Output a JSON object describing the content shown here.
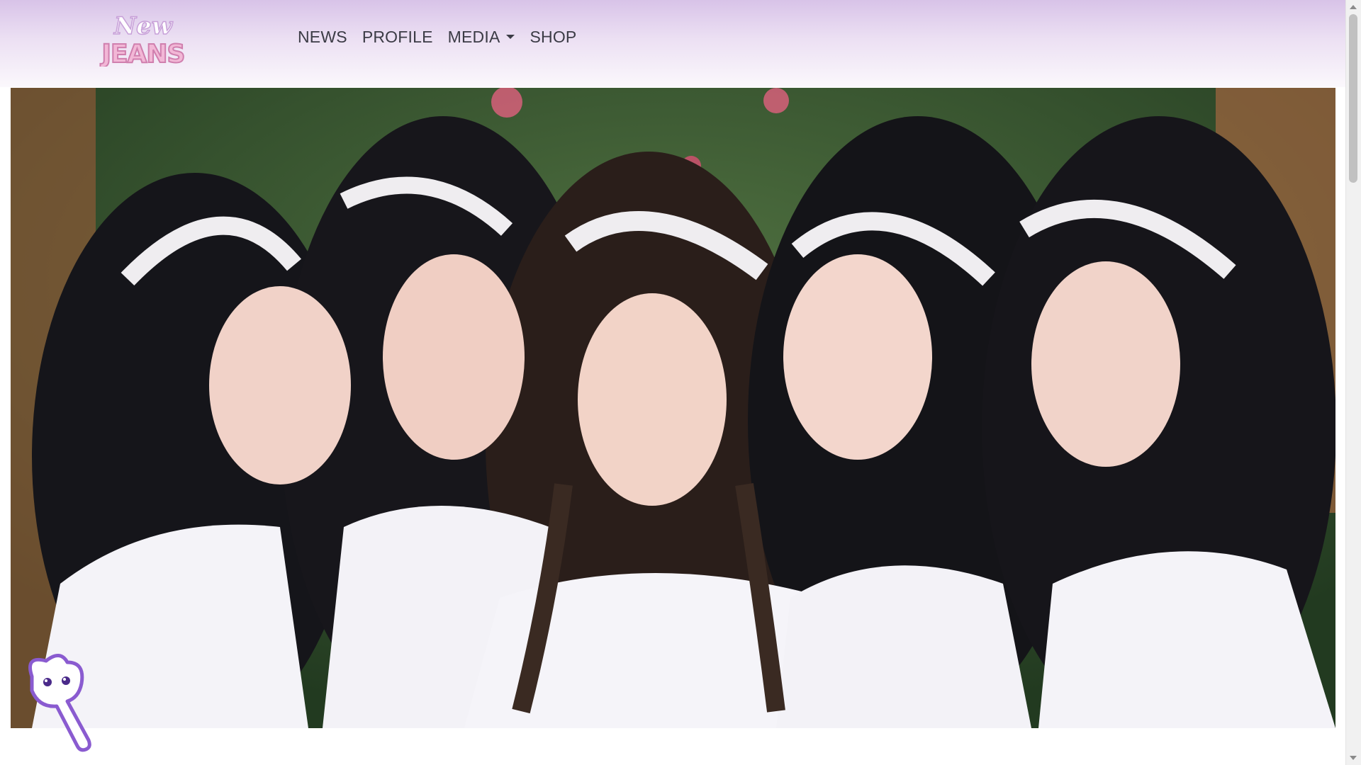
{
  "header": {
    "logo": {
      "line1": "New",
      "line2": "JEANS"
    },
    "nav": [
      {
        "label": "NEWS",
        "has_dropdown": false
      },
      {
        "label": "PROFILE",
        "has_dropdown": false
      },
      {
        "label": "MEDIA",
        "has_dropdown": true
      },
      {
        "label": "SHOP",
        "has_dropdown": false
      }
    ]
  },
  "hero": {
    "image_description": "Group photo of five members in white tops and white headbands in front of green foliage"
  },
  "colors": {
    "header_gradient_top": "#d8c3e8",
    "header_gradient_bottom": "#fbf8fc",
    "nav_text": "#3b3b45",
    "logo_pink": "#e8a4c8"
  },
  "icons": {
    "mascot": "bunny-cursor-icon",
    "dropdown": "caret-down-icon"
  }
}
